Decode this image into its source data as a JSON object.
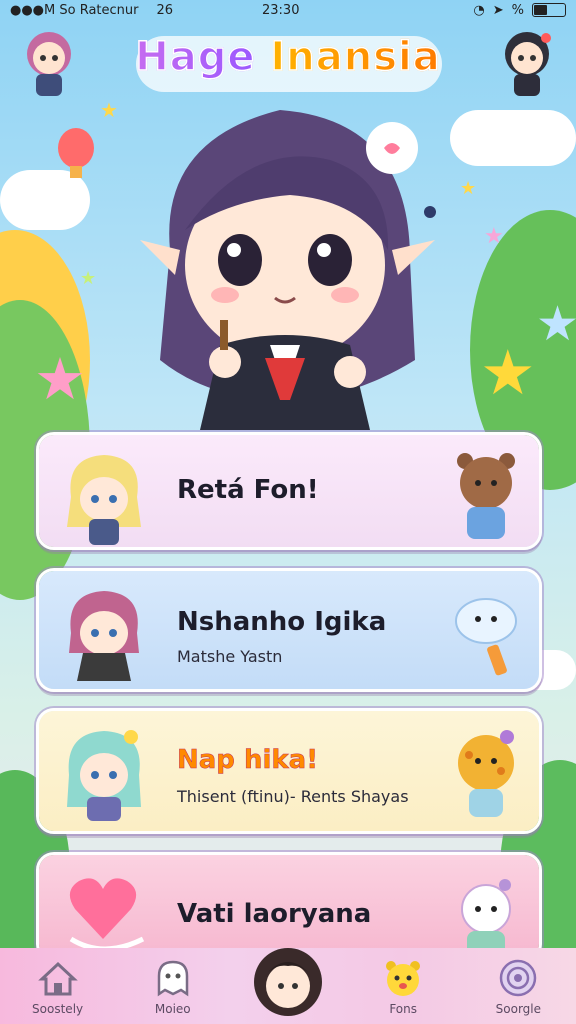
{
  "status_bar": {
    "carrier": "●●●M So Ratecnur",
    "signal_text": "26",
    "time": "23:30",
    "battery_text": "%"
  },
  "header": {
    "title_part1": "Hage",
    "title_part2": "Inansia"
  },
  "cards": [
    {
      "title": "Retá Fon!",
      "subtitle": "",
      "bg": "#f6e0f4"
    },
    {
      "title": "Nshanho Igika",
      "subtitle": "Matshe Yastn",
      "bg": "#cfe3fa"
    },
    {
      "title": "Nap hika!",
      "subtitle": "Thisent (ftinu)- Rents Shayas",
      "bg": "#fbf1cf"
    },
    {
      "title": "Vati laoryana",
      "subtitle": "",
      "bg": "#f9c6d8"
    }
  ],
  "bottom_nav": [
    {
      "label": "Soostely",
      "icon": "home-icon"
    },
    {
      "label": "Moieo",
      "icon": "ghost-icon"
    },
    {
      "label": "",
      "icon": "avatar-icon"
    },
    {
      "label": "Fons",
      "icon": "pet-icon"
    },
    {
      "label": "Soorgle",
      "icon": "swirl-icon"
    }
  ],
  "colors": {
    "accent_purple": "#9b59ff",
    "accent_orange": "#ff9a00",
    "nav_bg": "#f4c9e5"
  }
}
